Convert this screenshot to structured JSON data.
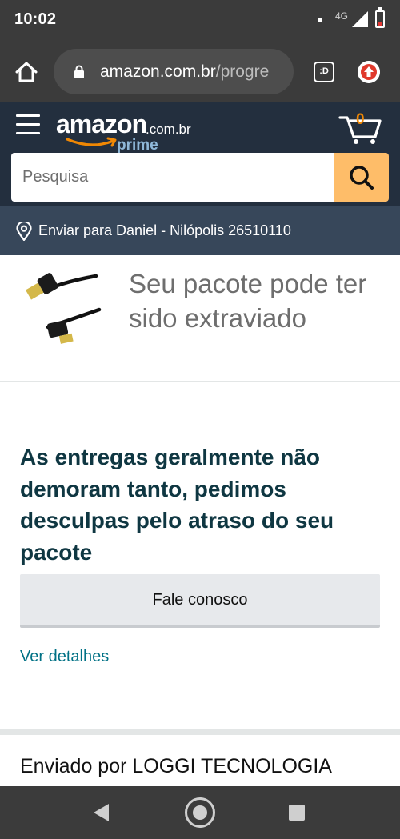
{
  "status_bar": {
    "time": "10:02",
    "network": "4G"
  },
  "browser": {
    "url_domain": "amazon.com.br",
    "url_path": "/progre",
    "tabs_badge": ":D"
  },
  "header": {
    "logo_word": "amazon",
    "logo_tld": ".com.br",
    "logo_prime": "prime",
    "cart_count": "0",
    "search_placeholder": "Pesquisa",
    "deliver_to": "Enviar para Daniel - Nilópolis 26510110"
  },
  "product": {
    "status": "Seu pacote pode ter sido extraviado"
  },
  "main": {
    "message": "As entregas geralmente não demoram tanto, pedimos desculpas pelo atraso do seu pacote",
    "contact_button": "Fale conosco",
    "details_link": "Ver detalhes",
    "shipper": "Enviado por LOGGI TECNOLOGIA"
  },
  "colors": {
    "header_bg": "#232f3e",
    "deliver_bg": "#37475a",
    "search_button": "#febd69",
    "cart_accent": "#f08804",
    "link": "#007185",
    "headline": "#0f3742"
  },
  "icons": {
    "home": "home-icon",
    "lock": "lock-icon",
    "tabs": "tab-switcher-icon",
    "update": "update-icon",
    "menu": "hamburger-menu-icon",
    "cart": "cart-icon",
    "search": "search-icon",
    "location": "location-pin-icon",
    "nav_back": "back-icon",
    "nav_home": "home-circle-icon",
    "nav_recent": "recent-apps-icon"
  }
}
